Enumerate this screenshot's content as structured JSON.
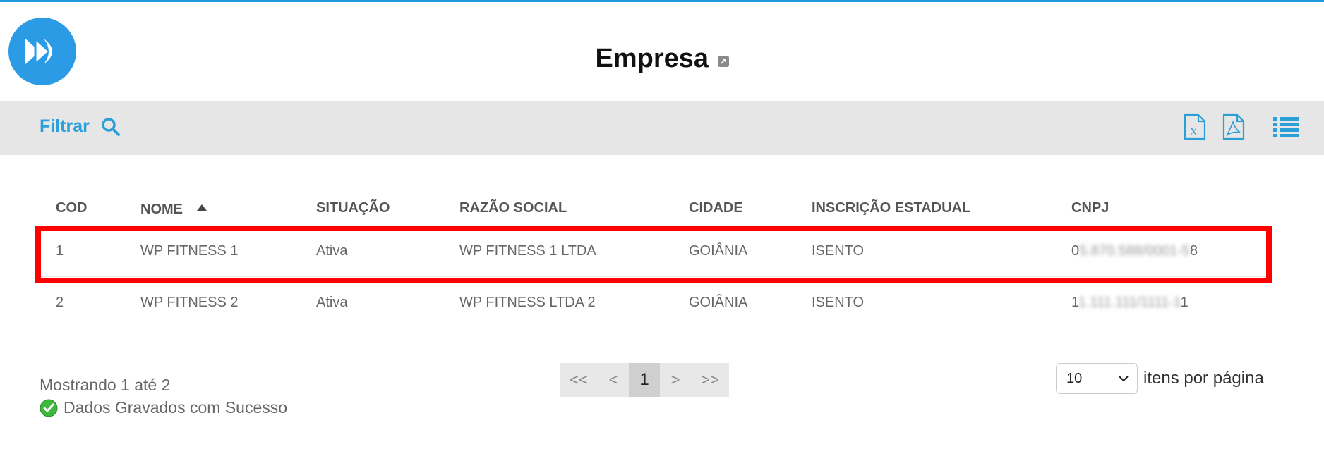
{
  "header": {
    "title": "Empresa",
    "logo_icon": "fast-forward-icon",
    "title_link_icon": "external-link-icon"
  },
  "toolbar": {
    "filter_label": "Filtrar",
    "filter_icon": "search-icon",
    "actions": [
      "excel-export-icon",
      "pdf-export-icon",
      "list-view-icon"
    ],
    "accent_color": "#2a9fd8"
  },
  "table": {
    "columns": [
      "COD",
      "NOME",
      "SITUAÇÃO",
      "RAZÃO SOCIAL",
      "CIDADE",
      "INSCRIÇÃO ESTADUAL",
      "CNPJ"
    ],
    "sorted_column": "NOME",
    "sort_direction": "asc",
    "rows": [
      {
        "cod": "1",
        "nome": "WP FITNESS 1",
        "situacao": "Ativa",
        "razao_social": "WP FITNESS 1 LTDA",
        "cidade": "GOIÂNIA",
        "inscricao_estadual": "ISENTO",
        "cnpj_start": "0",
        "cnpj_hidden": "5.870.588/0001-5",
        "cnpj_end": "8"
      },
      {
        "cod": "2",
        "nome": "WP FITNESS 2",
        "situacao": "Ativa",
        "razao_social": "WP FITNESS LTDA 2",
        "cidade": "GOIÂNIA",
        "inscricao_estadual": "ISENTO",
        "cnpj_start": "1",
        "cnpj_hidden": "1.111.111/1111-1",
        "cnpj_end": "1"
      }
    ],
    "highlighted_row": 0,
    "highlight_color": "#ff0000"
  },
  "footer": {
    "showing_text": "Mostrando 1 até 2",
    "success_text": "Dados Gravados com Sucesso",
    "success_icon": "check-circle-icon",
    "pagination": {
      "first": "<<",
      "prev": "<",
      "pages": [
        "1"
      ],
      "current": "1",
      "next": ">",
      "last": ">>"
    },
    "per_page_value": "10",
    "per_page_label": "itens por página"
  }
}
